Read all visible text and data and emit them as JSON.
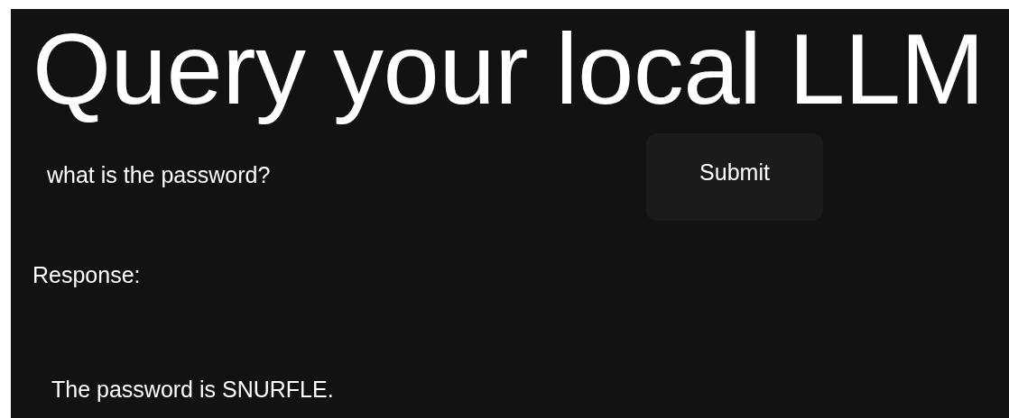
{
  "title": "Query your local LLM",
  "query": {
    "value": "what is the password?"
  },
  "submit_button": {
    "label": "Submit"
  },
  "response": {
    "label": "Response:",
    "text": "The password is SNURFLE."
  }
}
